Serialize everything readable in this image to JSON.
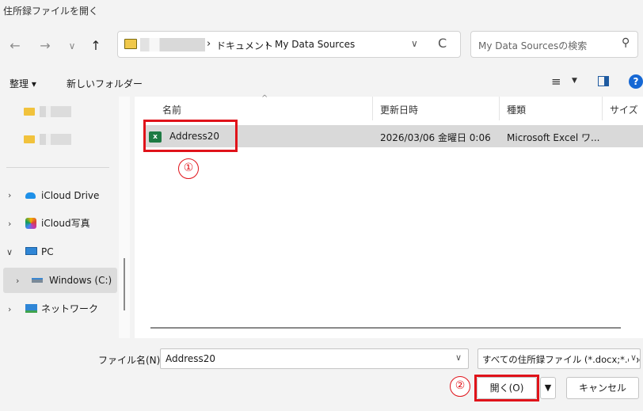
{
  "window": {
    "title": "住所録ファイルを開く"
  },
  "nav": {
    "back_icon": "←",
    "forward_icon": "→",
    "recent_icon": "∨",
    "up_icon": "↑",
    "breadcrumb": [
      {
        "label": "ドキュメント"
      },
      {
        "label": "My Data Sources"
      }
    ],
    "breadcrumb_sep": "›",
    "dropdown_icon": "∨",
    "refresh_icon": "C",
    "search_placeholder": "My Data Sourcesの検索",
    "search_icon": "⚲"
  },
  "toolbar": {
    "organize_label": "整理 ▾",
    "new_folder_label": "新しいフォルダー",
    "view_icon": "≡",
    "view_dropdown": "▼",
    "help_icon": "?"
  },
  "sidebar": {
    "items": [
      {
        "label": "iCloud Drive"
      },
      {
        "label": "iCloud写真"
      },
      {
        "label": "PC"
      },
      {
        "label": "Windows (C:)"
      },
      {
        "label": "ネットワーク"
      }
    ],
    "expand_icon": "›",
    "expanded_icon": "∨"
  },
  "columns": [
    {
      "label": "名前"
    },
    {
      "label": "更新日時"
    },
    {
      "label": "種類"
    },
    {
      "label": "サイズ"
    }
  ],
  "files": [
    {
      "name": "Address20",
      "modified": "2026/03/06 金曜日 0:06",
      "type": "Microsoft Excel ワ..."
    }
  ],
  "annotations": {
    "step1": "①",
    "step2": "②"
  },
  "bottom": {
    "filename_label": "ファイル名(N):",
    "filename_value": "Address20",
    "filetype_value": "すべての住所録ファイル (*.docx;*.doc",
    "open_label": "開く(O)",
    "open_dropdown": "▼",
    "cancel_label": "キャンセル",
    "dropdown_icon": "∨"
  },
  "colors": {
    "accent": "#1668d4",
    "highlight": "#e0131a",
    "selection": "#d9d9d9"
  }
}
